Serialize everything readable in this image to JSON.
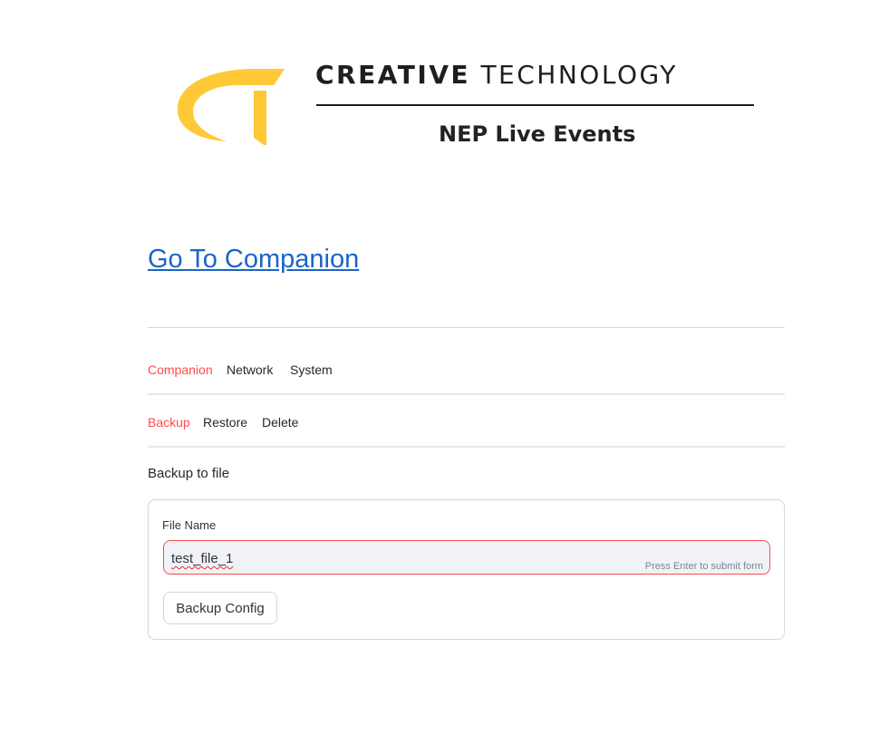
{
  "logo": {
    "brand_line_bold": "CREATIVE",
    "brand_line_light": "TECHNOLOGY",
    "sub_brand": "NEP Live Events",
    "mark_color": "#FFC837"
  },
  "link": {
    "label": "Go To Companion"
  },
  "tabs_main": [
    {
      "label": "Companion",
      "active": true
    },
    {
      "label": "Network",
      "active": false
    },
    {
      "label": "System",
      "active": false
    }
  ],
  "tabs_sub": [
    {
      "label": "Backup",
      "active": true
    },
    {
      "label": "Restore",
      "active": false
    },
    {
      "label": "Delete",
      "active": false
    }
  ],
  "section": {
    "title": "Backup to file"
  },
  "form": {
    "field_label": "File Name",
    "field_value": "test_file_1",
    "hint": "Press Enter to submit form",
    "submit_label": "Backup Config"
  },
  "colors": {
    "accent": "#ff4b4b",
    "link": "#1a64c8",
    "input_bg": "#f0f2f6",
    "border": "#d6d6d9"
  }
}
